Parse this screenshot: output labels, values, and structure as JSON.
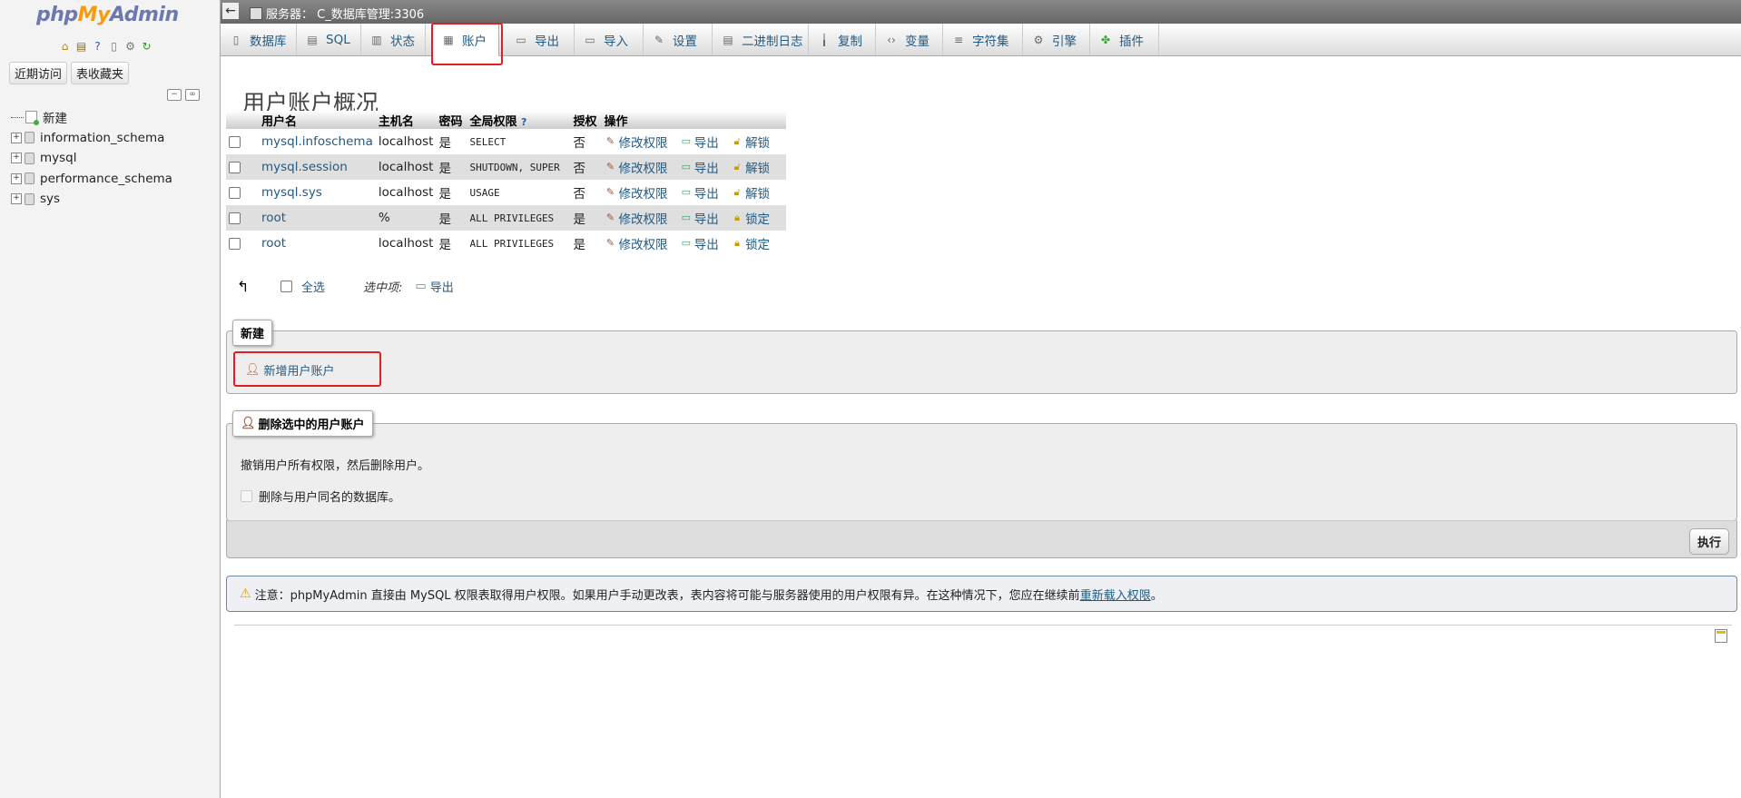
{
  "sidebar": {
    "logo": {
      "php": "php",
      "my": "My",
      "admin": "Admin"
    },
    "quick_icons": [
      "home-icon",
      "db-icon",
      "help-icon",
      "docs-icon",
      "settings-icon",
      "reload-icon"
    ],
    "tabs": {
      "recent": "近期访问",
      "favorites": "表收藏夹"
    },
    "tree": {
      "new": "新建",
      "databases": [
        "information_schema",
        "mysql",
        "performance_schema",
        "sys"
      ]
    }
  },
  "topbar": {
    "back": "←",
    "server": "服务器： C_数据库管理:3306"
  },
  "tabs": [
    "数据库",
    "SQL",
    "状态",
    "账户",
    "导出",
    "导入",
    "设置",
    "二进制日志",
    "复制",
    "变量",
    "字符集",
    "引擎",
    "插件"
  ],
  "main": {
    "title": "用户账户概况",
    "table": {
      "headers": [
        "用户名",
        "主机名",
        "密码",
        "全局权限",
        "授权",
        "操作"
      ],
      "rows": [
        {
          "user": "mysql.infoschema",
          "host": "localhost",
          "password": "是",
          "privileges": "SELECT",
          "grant": "否",
          "lock": "解锁"
        },
        {
          "user": "mysql.session",
          "host": "localhost",
          "password": "是",
          "privileges": "SHUTDOWN, SUPER",
          "grant": "否",
          "lock": "解锁"
        },
        {
          "user": "mysql.sys",
          "host": "localhost",
          "password": "是",
          "privileges": "USAGE",
          "grant": "否",
          "lock": "解锁"
        },
        {
          "user": "root",
          "host": "%",
          "password": "是",
          "privileges": "ALL PRIVILEGES",
          "grant": "是",
          "lock": "锁定"
        },
        {
          "user": "root",
          "host": "localhost",
          "password": "是",
          "privileges": "ALL PRIVILEGES",
          "grant": "是",
          "lock": "锁定"
        }
      ],
      "edit_label": "修改权限",
      "export_label": "导出"
    },
    "bulk": {
      "select_all": "全选",
      "with_selected": "选中项:",
      "export": "导出"
    },
    "new_section": {
      "legend": "新建",
      "add_user": "新增用户账户"
    },
    "delete_section": {
      "legend": "删除选中的用户账户",
      "revoke_text": "撤销用户所有权限，然后删除用户。",
      "drop_db": "删除与用户同名的数据库。",
      "execute": "执行"
    },
    "notice": {
      "text": "注意：phpMyAdmin 直接由 MySQL 权限表取得用户权限。如果用户手动更改表，表内容将可能与服务器使用的用户权限有异。在这种情况下，您应在继续前",
      "link": "重新载入权限",
      "end": "。"
    }
  }
}
